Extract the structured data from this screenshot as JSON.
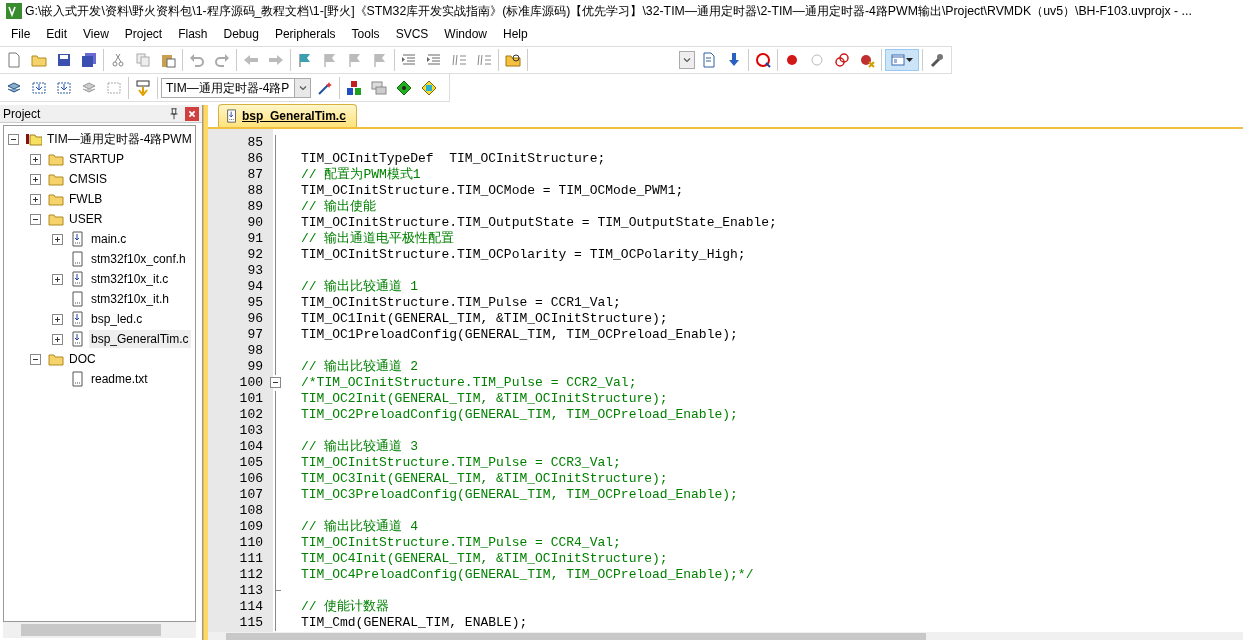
{
  "window": {
    "title": "G:\\嵌入式开发\\资料\\野火资料包\\1-程序源码_教程文档\\1-[野火]《STM32库开发实战指南》(标准库源码)【优先学习】\\32-TIM—通用定时器\\2-TIM—通用定时器-4路PWM输出\\Project\\RVMDK（uv5）\\BH-F103.uvprojx - ..."
  },
  "menu": [
    "File",
    "Edit",
    "View",
    "Project",
    "Flash",
    "Debug",
    "Peripherals",
    "Tools",
    "SVCS",
    "Window",
    "Help"
  ],
  "build_toolbar": {
    "target": "TIM—通用定时器-4路P"
  },
  "project_panel": {
    "title": "Project",
    "tree": [
      {
        "label": "TIM—通用定时器-4路PWM",
        "kind": "project",
        "expanded": true,
        "selected": false,
        "children": [
          {
            "label": "STARTUP",
            "kind": "folder",
            "expanded": false,
            "selected": false
          },
          {
            "label": "CMSIS",
            "kind": "folder",
            "expanded": false,
            "selected": false
          },
          {
            "label": "FWLB",
            "kind": "folder",
            "expanded": false,
            "selected": false
          },
          {
            "label": "USER",
            "kind": "folder",
            "expanded": true,
            "selected": false,
            "children": [
              {
                "label": "main.c",
                "kind": "source",
                "expanded": false,
                "selected": false
              },
              {
                "label": "stm32f10x_conf.h",
                "kind": "header",
                "selected": false
              },
              {
                "label": "stm32f10x_it.c",
                "kind": "source",
                "expanded": false,
                "selected": false
              },
              {
                "label": "stm32f10x_it.h",
                "kind": "header",
                "selected": false
              },
              {
                "label": "bsp_led.c",
                "kind": "source",
                "expanded": false,
                "selected": false
              },
              {
                "label": "bsp_GeneralTim.c",
                "kind": "source",
                "expanded": false,
                "selected": true
              }
            ]
          },
          {
            "label": "DOC",
            "kind": "folder",
            "expanded": true,
            "selected": false,
            "children": [
              {
                "label": "readme.txt",
                "kind": "header",
                "selected": false
              }
            ]
          }
        ]
      }
    ]
  },
  "editor": {
    "tabs": [
      {
        "label": "bsp_GeneralTim.c",
        "selected": true
      }
    ],
    "lines": [
      {
        "number": "85"
      },
      {
        "number": "86",
        "kind": "code",
        "text": "TIM_OCInitTypeDef  TIM_OCInitStructure;"
      },
      {
        "number": "87",
        "kind": "comment",
        "text": "// 配置为PWM模式1"
      },
      {
        "number": "88",
        "kind": "code",
        "text": "TIM_OCInitStructure.TIM_OCMode = TIM_OCMode_PWM1;"
      },
      {
        "number": "89",
        "kind": "comment",
        "text": "// 输出使能"
      },
      {
        "number": "90",
        "kind": "code",
        "text": "TIM_OCInitStructure.TIM_OutputState = TIM_OutputState_Enable;"
      },
      {
        "number": "91",
        "kind": "comment",
        "text": "// 输出通道电平极性配置"
      },
      {
        "number": "92",
        "kind": "code",
        "text": "TIM_OCInitStructure.TIM_OCPolarity = TIM_OCPolarity_High;"
      },
      {
        "number": "93"
      },
      {
        "number": "94",
        "kind": "comment",
        "text": "// 输出比较通道 1"
      },
      {
        "number": "95",
        "kind": "code",
        "text": "TIM_OCInitStructure.TIM_Pulse = CCR1_Val;"
      },
      {
        "number": "96",
        "kind": "code",
        "text": "TIM_OC1Init(GENERAL_TIM, &TIM_OCInitStructure);"
      },
      {
        "number": "97",
        "kind": "code",
        "text": "TIM_OC1PreloadConfig(GENERAL_TIM, TIM_OCPreload_Enable);"
      },
      {
        "number": "98"
      },
      {
        "number": "99",
        "kind": "comment",
        "text": "// 输出比较通道 2"
      },
      {
        "number": "100",
        "kind": "comment",
        "folded": false,
        "text": "/*TIM_OCInitStructure.TIM_Pulse = CCR2_Val;"
      },
      {
        "number": "101",
        "kind": "comment",
        "text": "TIM_OC2Init(GENERAL_TIM, &TIM_OCInitStructure);"
      },
      {
        "number": "102",
        "kind": "comment",
        "text": "TIM_OC2PreloadConfig(GENERAL_TIM, TIM_OCPreload_Enable);"
      },
      {
        "number": "103"
      },
      {
        "number": "104",
        "kind": "comment",
        "text": "// 输出比较通道 3"
      },
      {
        "number": "105",
        "kind": "comment",
        "text": "TIM_OCInitStructure.TIM_Pulse = CCR3_Val;"
      },
      {
        "number": "106",
        "kind": "comment",
        "text": "TIM_OC3Init(GENERAL_TIM, &TIM_OCInitStructure);"
      },
      {
        "number": "107",
        "kind": "comment",
        "text": "TIM_OC3PreloadConfig(GENERAL_TIM, TIM_OCPreload_Enable);"
      },
      {
        "number": "108"
      },
      {
        "number": "109",
        "kind": "comment",
        "text": "// 输出比较通道 4"
      },
      {
        "number": "110",
        "kind": "comment",
        "text": "TIM_OCInitStructure.TIM_Pulse = CCR4_Val;"
      },
      {
        "number": "111",
        "kind": "comment",
        "text": "TIM_OC4Init(GENERAL_TIM, &TIM_OCInitStructure);"
      },
      {
        "number": "112",
        "kind": "comment",
        "text": "TIM_OC4PreloadConfig(GENERAL_TIM, TIM_OCPreload_Enable);*/"
      },
      {
        "number": "113",
        "fold_end": true
      },
      {
        "number": "114",
        "kind": "comment",
        "text": "// 使能计数器"
      },
      {
        "number": "115",
        "kind": "code",
        "text": "TIM_Cmd(GENERAL_TIM, ENABLE);"
      }
    ]
  }
}
